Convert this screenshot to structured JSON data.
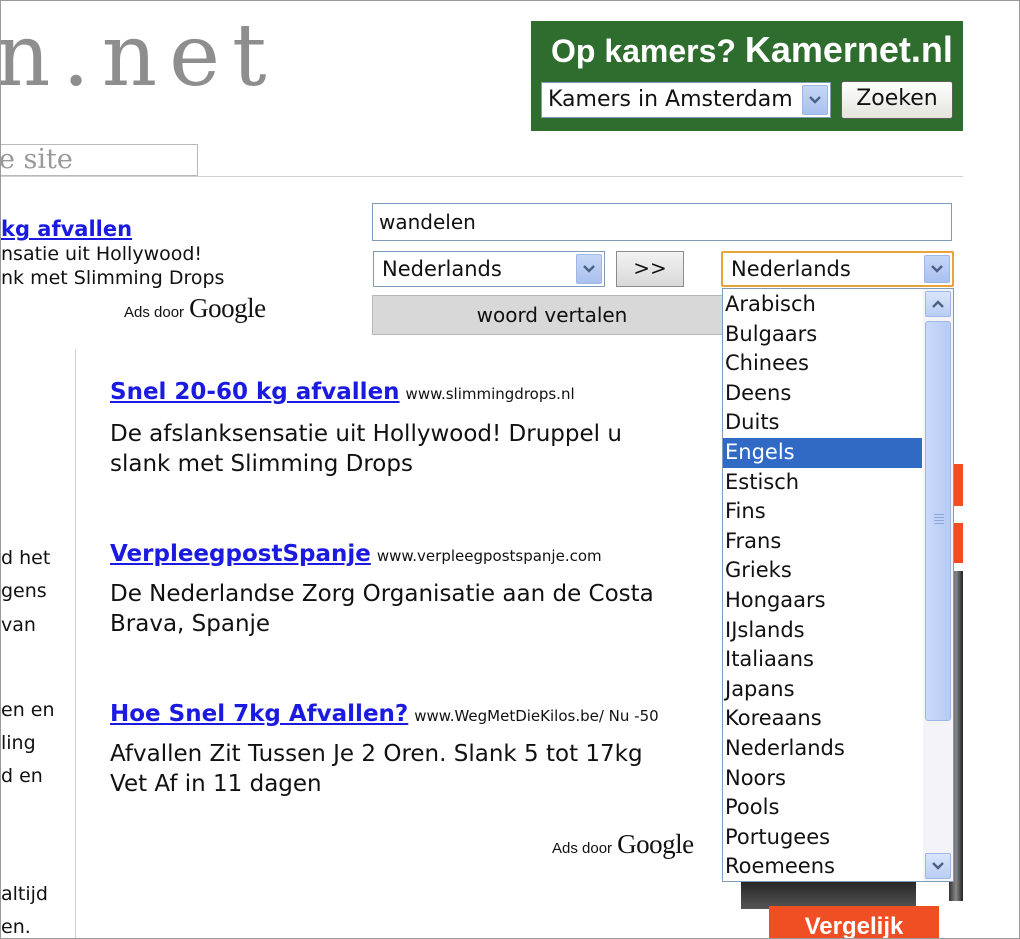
{
  "logo": {
    "text": "n.net"
  },
  "site_field": {
    "value": "e site"
  },
  "banner": {
    "title_prefix": "Op kamers?",
    "title_brand": "Kamernet.nl",
    "select_value": "Kamers in Amsterdam",
    "search_label": "Zoeken",
    "bg_color": "#2f6d2f"
  },
  "left_ad": {
    "title": "kg afvallen",
    "line1": "nsatie uit Hollywood!",
    "line2": "nk met Slimming Drops"
  },
  "ads_by": {
    "label": "Ads door",
    "brand": "Google"
  },
  "translator": {
    "word_value": "wandelen",
    "source_lang": "Nederlands",
    "swap_label": ">>",
    "target_lang": "Nederlands",
    "translate_label": "woord vertalen"
  },
  "language_list": {
    "selected": "Engels",
    "options": [
      "Arabisch",
      "Bulgaars",
      "Chinees",
      "Deens",
      "Duits",
      "Engels",
      "Estisch",
      "Fins",
      "Frans",
      "Grieks",
      "Hongaars",
      "IJslands",
      "Italiaans",
      "Japans",
      "Koreaans",
      "Nederlands",
      "Noors",
      "Pools",
      "Portugees",
      "Roemeens"
    ]
  },
  "left_fragments": [
    "d het",
    "gens",
    "van",
    "en en",
    "ling",
    "d en",
    "altijd",
    "en."
  ],
  "ads": [
    {
      "title": "Snel 20-60 kg afvallen",
      "url": "www.slimmingdrops.nl",
      "body1": "De afslanksensatie uit Hollywood! Druppel u",
      "body2": "slank met Slimming Drops"
    },
    {
      "title": "VerpleegpostSpanje",
      "url": "www.verpleegpostspanje.com",
      "body1": "De Nederlandse Zorg Organisatie aan de Costa",
      "body2": "Brava, Spanje"
    },
    {
      "title": "Hoe Snel 7kg Afvallen?",
      "url": "www.WegMetDieKilos.be/ Nu -50",
      "body1": "Afvallen Zit Tussen Je 2 Oren. Slank 5 tot 17kg",
      "body2": "Vet Af in 11 dagen"
    }
  ],
  "compare_button": {
    "label": "Vergelijk"
  },
  "colors": {
    "link": "#1a1ae0",
    "selection": "#316ac5",
    "accent_orange": "#f04e23"
  }
}
